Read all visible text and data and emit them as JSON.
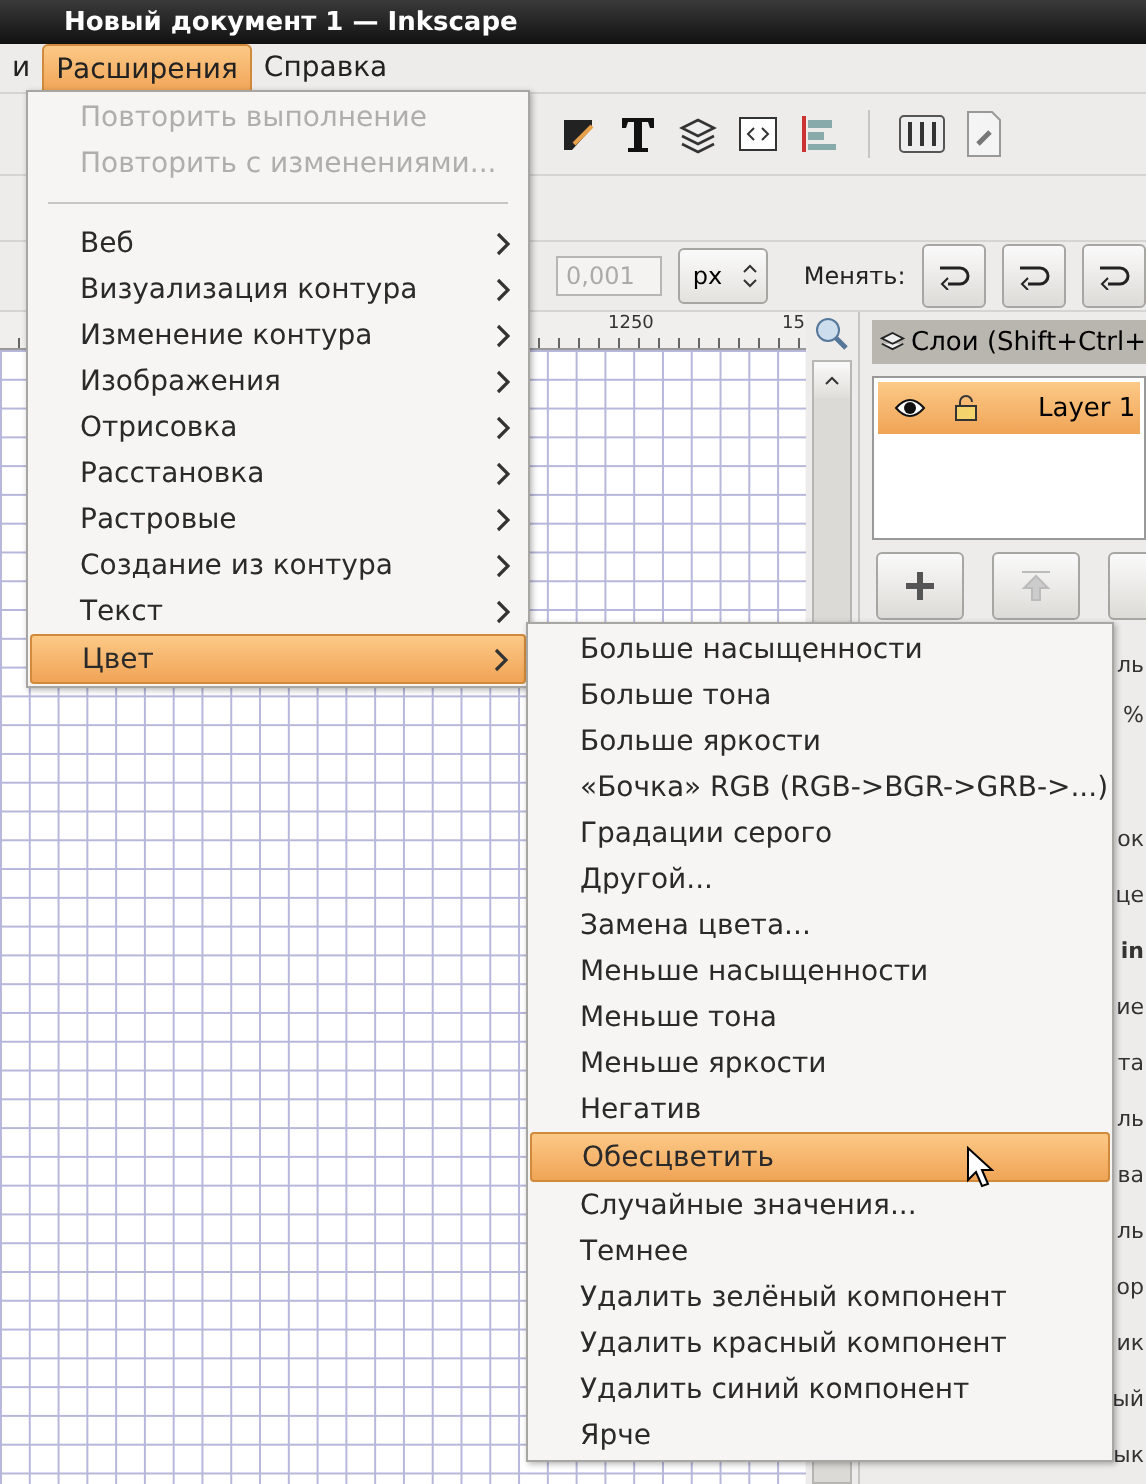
{
  "window": {
    "title": "Новый документ 1 — Inkscape"
  },
  "menubar": [
    {
      "label": "и",
      "selected": false
    },
    {
      "label": "Расширения",
      "selected": true
    },
    {
      "label": "Справка",
      "selected": false
    }
  ],
  "toolbar_units": {
    "value": "0,001",
    "unit": "px",
    "label": "Менять:"
  },
  "ruler": {
    "labels": [
      "1250",
      "15"
    ]
  },
  "layers_panel": {
    "title": "Слои (Shift+Ctrl+",
    "layers": [
      {
        "name": "Layer 1",
        "selected": true
      }
    ]
  },
  "dock_fragments": {
    "mode_rows": [
      "ль",
      "%"
    ],
    "metadata_rows": [
      "ок",
      "це",
      "in",
      "ие",
      "та",
      "ль",
      "ва",
      "ль",
      "ор",
      "ик",
      "ый",
      "ык"
    ]
  },
  "menu": {
    "items": [
      {
        "kind": "action",
        "label": "Повторить выполнение",
        "disabled": true
      },
      {
        "kind": "action",
        "label": "Повторить с изменениями...",
        "disabled": true
      },
      {
        "kind": "separator"
      },
      {
        "kind": "submenu",
        "label": "Веб",
        "selected": false
      },
      {
        "kind": "submenu",
        "label": "Визуализация контура",
        "selected": false
      },
      {
        "kind": "submenu",
        "label": "Изменение контура",
        "selected": false
      },
      {
        "kind": "submenu",
        "label": "Изображения",
        "selected": false
      },
      {
        "kind": "submenu",
        "label": "Отрисовка",
        "selected": false
      },
      {
        "kind": "submenu",
        "label": "Расстановка",
        "selected": false
      },
      {
        "kind": "submenu",
        "label": "Растровые",
        "selected": false
      },
      {
        "kind": "submenu",
        "label": "Создание из контура",
        "selected": false
      },
      {
        "kind": "submenu",
        "label": "Текст",
        "selected": false
      },
      {
        "kind": "submenu",
        "label": "Цвет",
        "selected": true
      }
    ]
  },
  "submenu": {
    "items": [
      {
        "label": "Больше насыщенности",
        "selected": false
      },
      {
        "label": "Больше тона",
        "selected": false
      },
      {
        "label": "Больше яркости",
        "selected": false
      },
      {
        "label": "«Бочка» RGB (RGB->BGR->GRB->...)",
        "selected": false
      },
      {
        "label": "Градации серого",
        "selected": false
      },
      {
        "label": "Другой...",
        "selected": false
      },
      {
        "label": "Замена цвета...",
        "selected": false
      },
      {
        "label": "Меньше насыщенности",
        "selected": false
      },
      {
        "label": "Меньше тона",
        "selected": false
      },
      {
        "label": "Меньше яркости",
        "selected": false
      },
      {
        "label": "Негатив",
        "selected": false
      },
      {
        "label": "Обесцветить",
        "selected": true
      },
      {
        "label": "Случайные значения...",
        "selected": false
      },
      {
        "label": "Темнее",
        "selected": false
      },
      {
        "label": "Удалить зелёный компонент",
        "selected": false
      },
      {
        "label": "Удалить красный компонент",
        "selected": false
      },
      {
        "label": "Удалить синий компонент",
        "selected": false
      },
      {
        "label": "Ярче",
        "selected": false
      }
    ]
  }
}
